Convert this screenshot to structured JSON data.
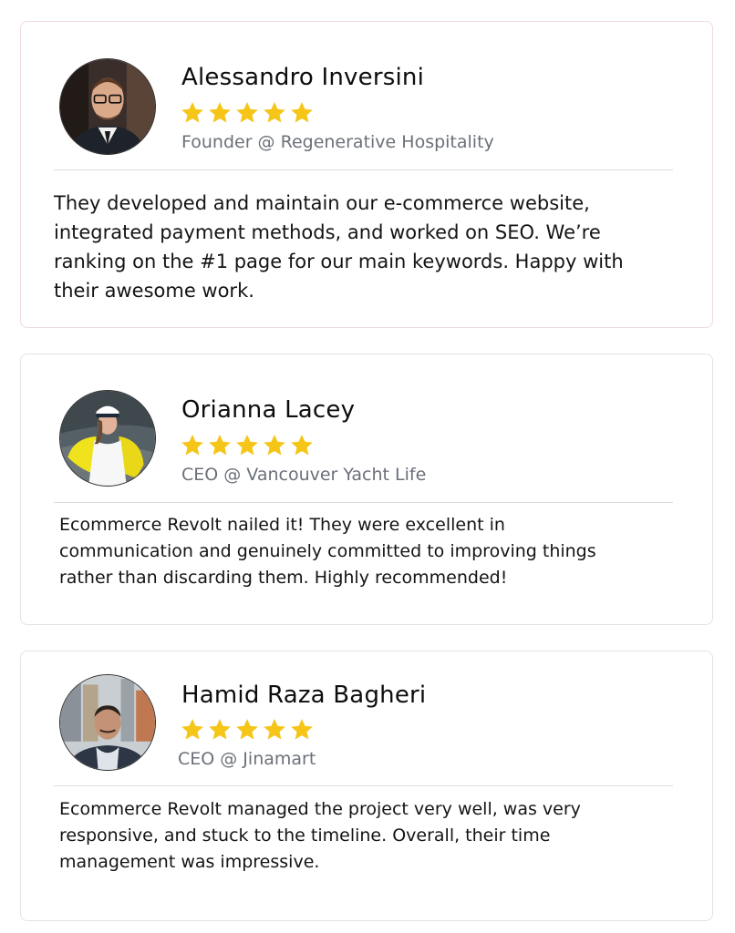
{
  "accent_star_color": "#f5c518",
  "testimonials": [
    {
      "name": "Alessandro Inversini",
      "rating": 5,
      "role": "Founder @ Regenerative Hospitality",
      "quote_lines": [
        "They developed and maintain our e-commerce website,",
        "integrated payment methods, and worked on SEO. We’re",
        "ranking on the #1 page for our main keywords. Happy with",
        "their awesome work."
      ]
    },
    {
      "name": "Orianna Lacey",
      "rating": 5,
      "role": "CEO @ Vancouver Yacht Life",
      "quote_lines": [
        "Ecommerce Revolt nailed it! They were excellent in",
        "communication and genuinely committed to improving things",
        "rather than discarding them. Highly recommended!"
      ]
    },
    {
      "name": "Hamid Raza Bagheri",
      "rating": 5,
      "role": "CEO @ Jinamart",
      "quote_lines": [
        "Ecommerce Revolt managed the project very well, was very",
        "responsive, and stuck to the timeline. Overall, their time",
        "management was impressive."
      ]
    }
  ]
}
